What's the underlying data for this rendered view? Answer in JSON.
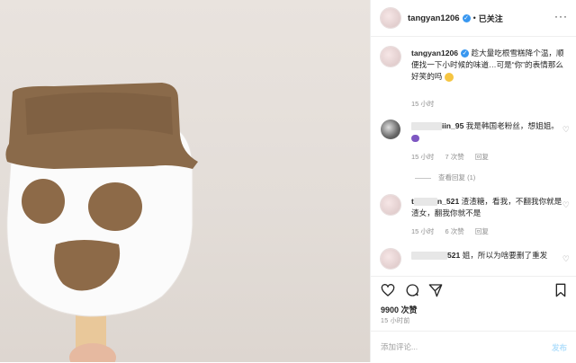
{
  "header": {
    "username": "tangyan1206",
    "separator": "•",
    "follow_label": "已关注",
    "more_label": "···"
  },
  "caption": {
    "username": "tangyan1206",
    "text": "趁大量吃根雪糕降个温，顺便找一下小时候的味道…可是“你”的表情那么好笑的吗",
    "time": "15 小时"
  },
  "comments": [
    {
      "username_suffix": "iin_95",
      "text": "我是韩国老粉丝，想姐姐。",
      "time": "15 小时",
      "likes": "7 次赞",
      "reply": "回复",
      "view_replies": "查看回复 (1)"
    },
    {
      "username_prefix": "t",
      "username_suffix": "n_521",
      "text": "渣渣糖，看我，不翻我你就是渣女，翻我你就不是",
      "time": "15 小时",
      "likes": "6 次赞",
      "reply": "回复"
    },
    {
      "username_suffix": "521",
      "text": "姐，所以为啥要删了重发",
      "time": ""
    }
  ],
  "actions": {
    "like_icon": "heart-icon",
    "comment_icon": "comment-icon",
    "share_icon": "share-icon",
    "save_icon": "bookmark-icon"
  },
  "likes": "9900 次赞",
  "timestamp": "15 小时前",
  "comment_input": {
    "placeholder": "添加评论...",
    "post_label": "发布"
  },
  "colors": {
    "verified": "#3897f0",
    "muted": "#8e8e8e",
    "post_disabled": "#b2dffc"
  }
}
